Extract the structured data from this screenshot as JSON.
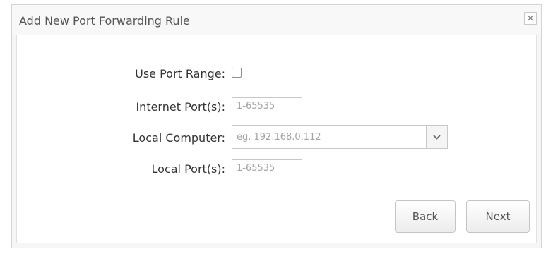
{
  "dialog": {
    "title": "Add New Port Forwarding Rule",
    "close_label": "×"
  },
  "form": {
    "use_port_range": {
      "label": "Use Port Range:",
      "checked": false
    },
    "internet_ports": {
      "label": "Internet Port(s):",
      "value": "",
      "placeholder": "1-65535"
    },
    "local_computer": {
      "label": "Local Computer:",
      "value": "",
      "placeholder": "eg. 192.168.0.112",
      "dropdown_icon": "chevron-down-icon"
    },
    "local_ports": {
      "label": "Local Port(s):",
      "value": "",
      "placeholder": "1-65535"
    }
  },
  "buttons": {
    "back_label": "Back",
    "next_label": "Next"
  }
}
